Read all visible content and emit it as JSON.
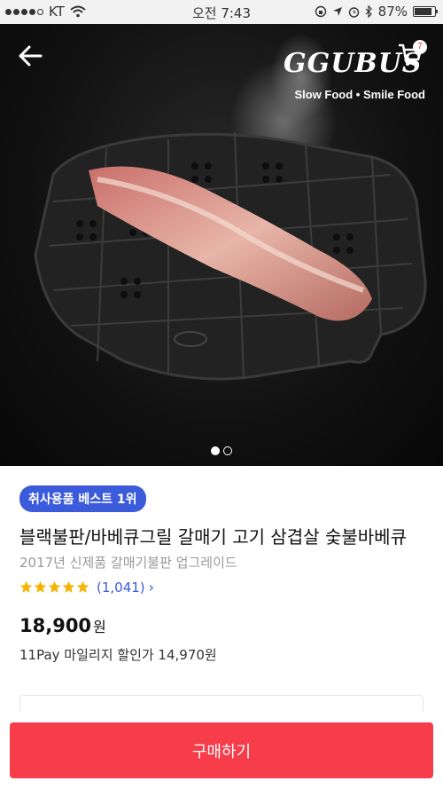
{
  "status_bar": {
    "carrier": "KT",
    "time": "오전 7:43",
    "battery": "87%"
  },
  "hero": {
    "brand_logo": "GGUBUS",
    "brand_tagline": "Slow Food • Smile Food",
    "cart_count": "7",
    "page_total": 2,
    "page_current": 1
  },
  "product": {
    "badge": "취사용품 베스트 1위",
    "title": "블랙불판/바베큐그릴 갈매기 고기 삼겹살 숯불바베큐",
    "subtitle": "2017년 신제품  갈매기불판 업그레이드",
    "rating_stars": 5,
    "rating_count": "(1,041)",
    "price": "18,900",
    "price_unit": "원",
    "mileage_text": "11Pay 마일리지 할인가 14,970원"
  },
  "bottom": {
    "buy_label": "구매하기"
  },
  "colors": {
    "badge_bg": "#3b5bdb",
    "buy_bg": "#f73c4a",
    "star": "#f6b400"
  }
}
